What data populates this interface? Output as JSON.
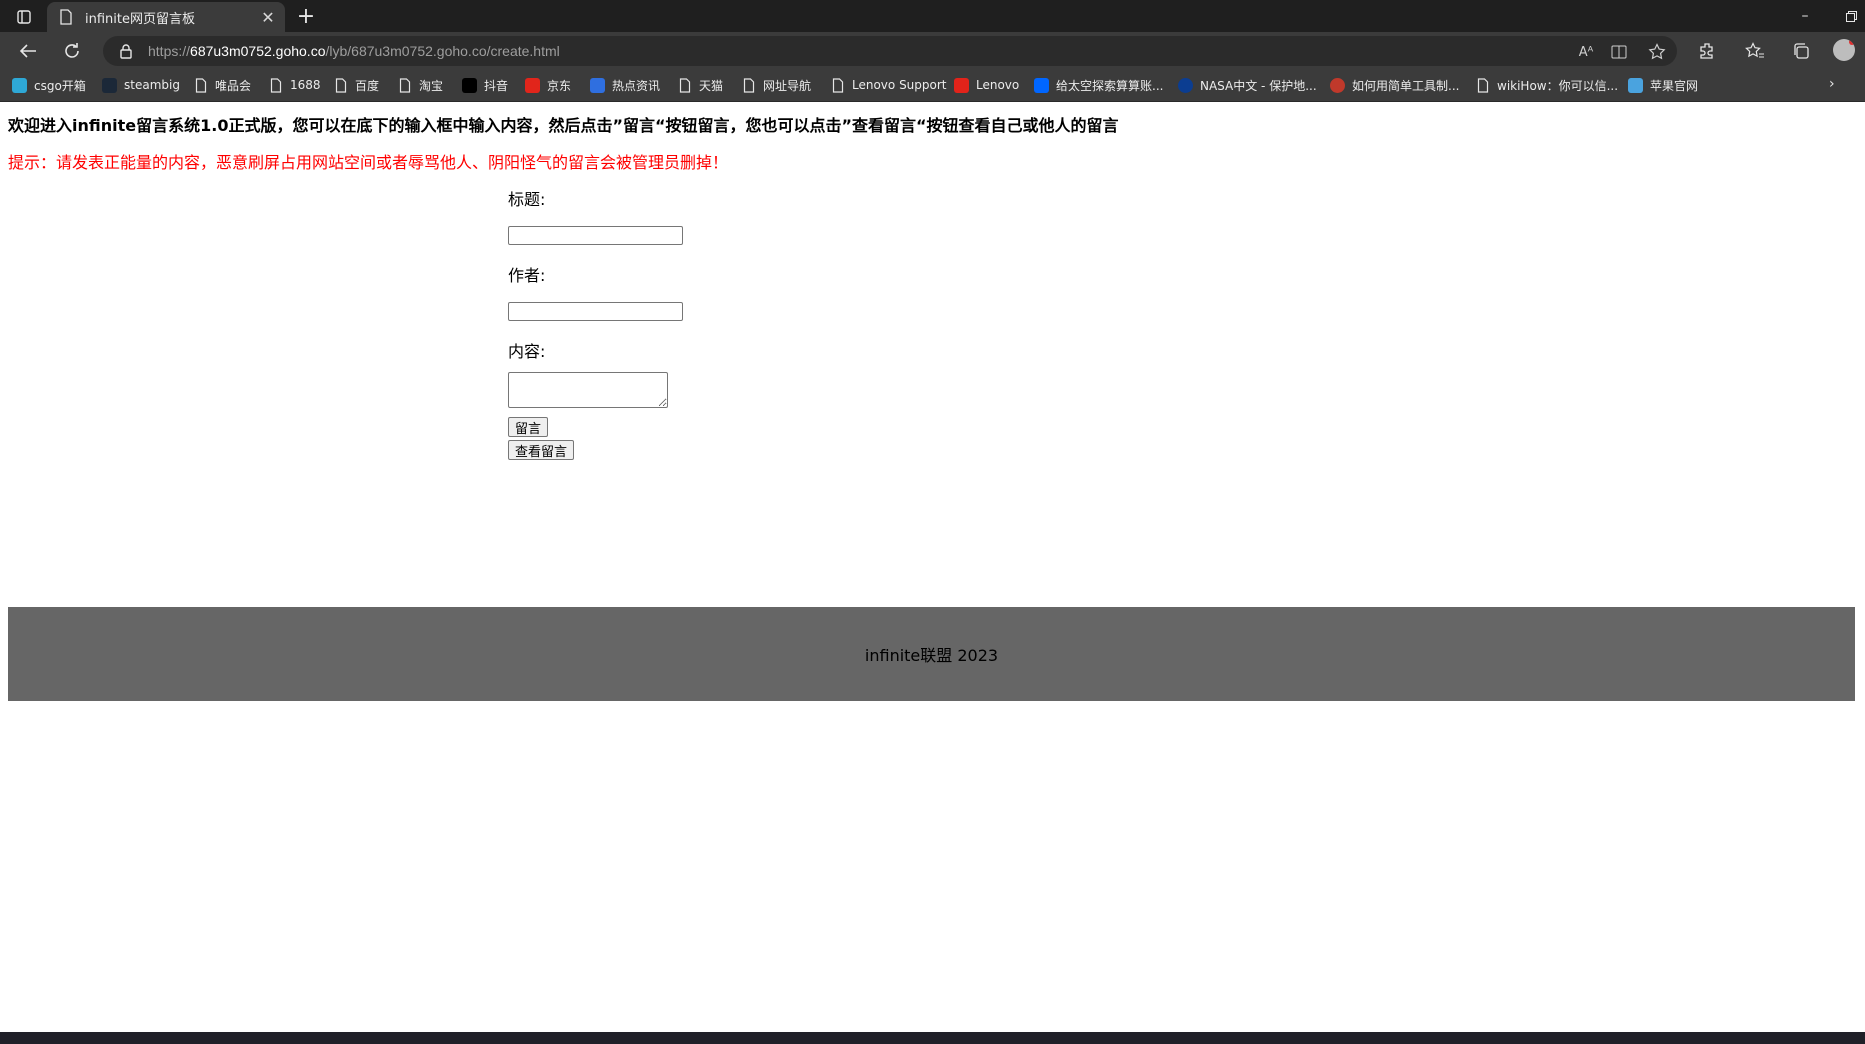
{
  "browser": {
    "tab_title": "infinite网页留言板",
    "url_prefix": "https://",
    "url_host": "687u3m0752.goho.co",
    "url_path": "/lyb/687u3m0752.goho.co/create.html",
    "accent": "#3b3b3b"
  },
  "bookmarks": [
    {
      "label": "csgo开箱",
      "icon": "csgo-icon",
      "color": "#2ea8d6"
    },
    {
      "label": "steambig",
      "icon": "steam-icon",
      "color": "#1b2838"
    },
    {
      "label": "唯品会",
      "icon": "page-icon",
      "color": ""
    },
    {
      "label": "1688",
      "icon": "page-icon",
      "color": ""
    },
    {
      "label": "百度",
      "icon": "page-icon",
      "color": ""
    },
    {
      "label": "淘宝",
      "icon": "page-icon",
      "color": ""
    },
    {
      "label": "抖音",
      "icon": "tiktok-icon",
      "color": "#000000"
    },
    {
      "label": "京东",
      "icon": "jd-icon",
      "color": "#e1251b"
    },
    {
      "label": "热点资讯",
      "icon": "news-icon",
      "color": "#2f6fe0"
    },
    {
      "label": "天猫",
      "icon": "page-icon",
      "color": ""
    },
    {
      "label": "网址导航",
      "icon": "page-icon",
      "color": ""
    },
    {
      "label": "Lenovo Support",
      "icon": "page-icon",
      "color": ""
    },
    {
      "label": "Lenovo",
      "icon": "lenovo-icon",
      "color": "#e2231a"
    },
    {
      "label": "给太空探索算算账...",
      "icon": "zhihu-icon",
      "color": "#0066ff"
    },
    {
      "label": "NASA中文 - 保护地...",
      "icon": "nasa-icon",
      "color": "#0b3d91"
    },
    {
      "label": "如何用简单工具制...",
      "icon": "red-circle-icon",
      "color": "#c0392b"
    },
    {
      "label": "wikiHow：你可以信...",
      "icon": "page-icon",
      "color": ""
    },
    {
      "label": "苹果官网",
      "icon": "gear-flower-icon",
      "color": "#4aa3df"
    }
  ],
  "content": {
    "welcome": "欢迎进入infinite留言系统1.0正式版，您可以在底下的输入框中输入内容，然后点击”留言“按钮留言，您也可以点击”查看留言“按钮查看自己或他人的留言",
    "tip": "提示：请发表正能量的内容，恶意刷屏占用网站空间或者辱骂他人、阴阳怪气的留言会被管理员删掉！",
    "tip_color": "#ff0000"
  },
  "form": {
    "title_label": "标题:",
    "title_value": "",
    "author_label": "作者:",
    "author_value": "",
    "content_label": "内容:",
    "content_value": "",
    "submit_label": "留言",
    "view_label": "查看留言"
  },
  "footer": {
    "text": "infinite联盟 2023",
    "bg": "#666666"
  }
}
